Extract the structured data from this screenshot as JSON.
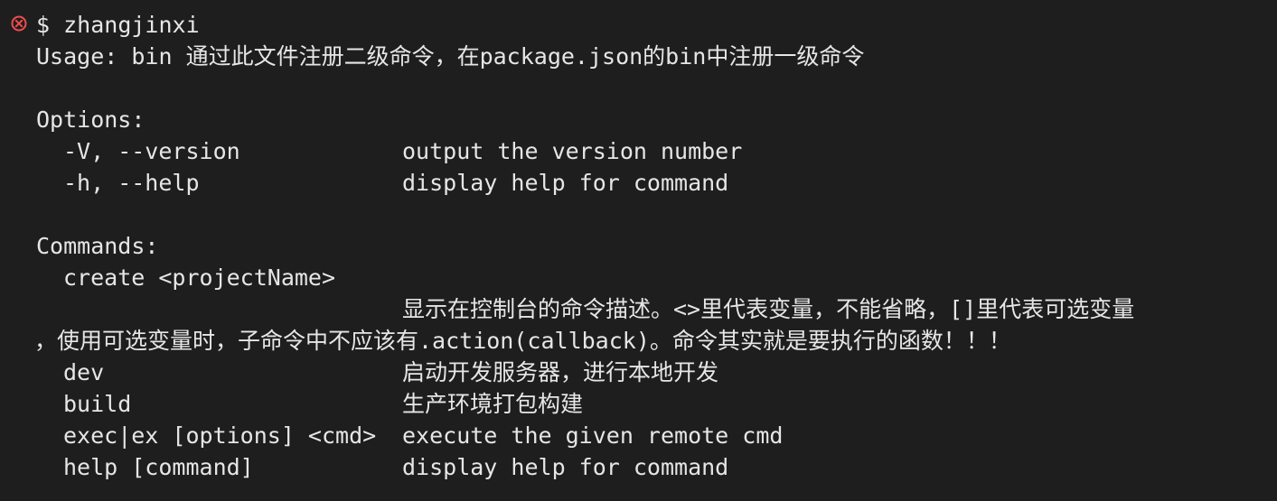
{
  "colors": {
    "background": "#1e1e1e",
    "text": "#e6e6e6",
    "error": "#f14c4c"
  },
  "prompt": {
    "icon": "error-circle-icon",
    "symbol": "$",
    "command": "zhangjinxi"
  },
  "usage": "Usage: bin 通过此文件注册二级命令，在package.json的bin中注册一级命令",
  "options": {
    "header": "Options:",
    "items": [
      {
        "flag": "-V, --version",
        "desc": "output the version number"
      },
      {
        "flag": "-h, --help",
        "desc": "display help for command"
      }
    ]
  },
  "commands": {
    "header": "Commands:",
    "create": {
      "name": "create <projectName>",
      "desc_line1": "显示在控制台的命令描述。<>里代表变量，不能省略，[]里代表可选变量",
      "desc_line2": "，使用可选变量时，子命令中不应该有.action(callback)。命令其实就是要执行的函数！！！"
    },
    "items": [
      {
        "name": "dev",
        "desc": "启动开发服务器，进行本地开发"
      },
      {
        "name": "build",
        "desc": "生产环境打包构建"
      },
      {
        "name": "exec|ex [options] <cmd>",
        "desc": "execute the given remote cmd"
      },
      {
        "name": "help [command]",
        "desc": "display help for command"
      }
    ]
  }
}
